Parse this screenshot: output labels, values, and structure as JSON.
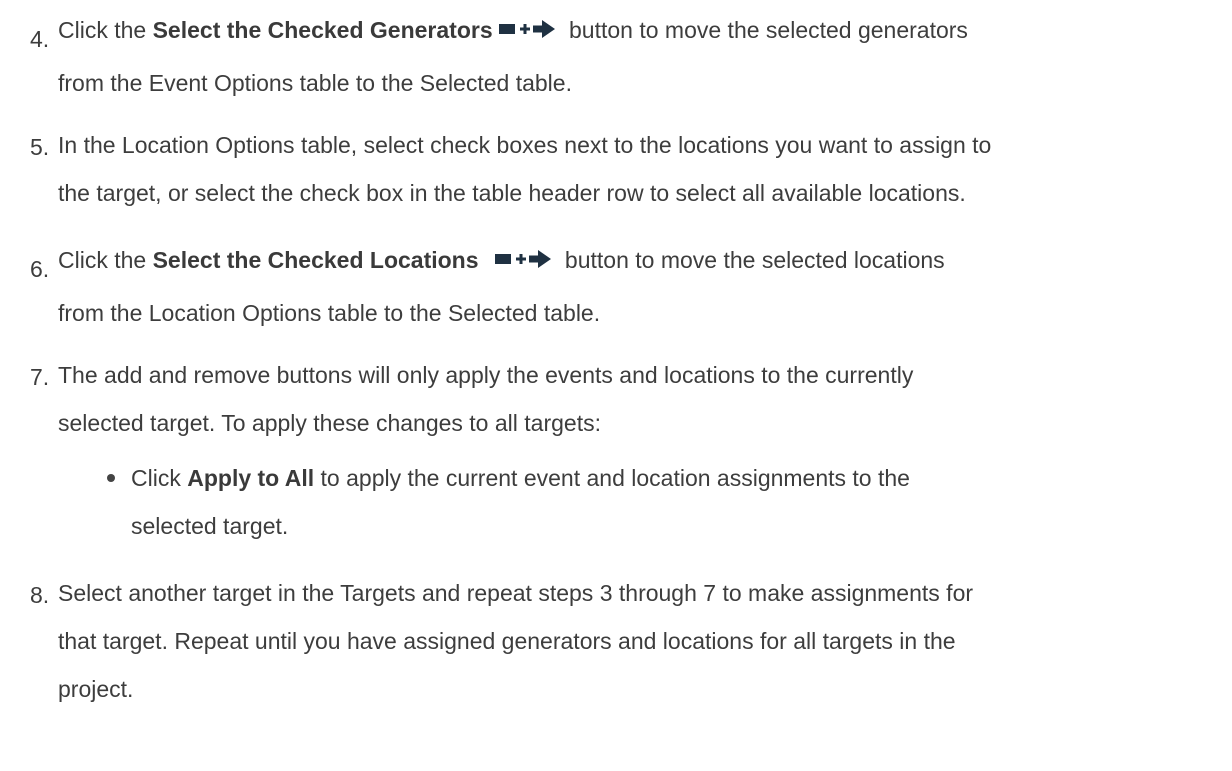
{
  "steps": [
    {
      "number": "4.",
      "line1_pre": "Click the ",
      "line1_bold": "Select the Checked Generators",
      "line1_post": " button to move the selected generators",
      "line2": "from the Event Options table to the Selected table.",
      "icon": "select-checked-arrow-icon"
    },
    {
      "number": "5.",
      "line1": "In the Location Options table, select check boxes next to the locations you want to assign to",
      "line2": "the target, or select the check box in the table header row to select all available locations."
    },
    {
      "number": "6.",
      "line1_pre": "Click the ",
      "line1_bold": "Select the Checked Locations",
      "line1_post": " button to move the selected locations",
      "line2": "from the Location Options table to the Selected table.",
      "icon": "select-checked-arrow-icon"
    },
    {
      "number": "7.",
      "line1": "The add and remove buttons will only apply the events and locations to the currently",
      "line2": "selected target. To apply these changes to all targets:",
      "bullet": {
        "pre": "Click ",
        "bold": "Apply to All",
        "post": " to apply the current event and location assignments to the",
        "line2": "selected target."
      }
    },
    {
      "number": "8.",
      "line1": "Select another target in the Targets and repeat steps 3 through 7 to make assignments for",
      "line2": "that target. Repeat until you have assigned generators and locations for all targets in the",
      "line3": "project."
    }
  ],
  "colors": {
    "text": "#3d3d3d",
    "icon": "#1f3142"
  }
}
